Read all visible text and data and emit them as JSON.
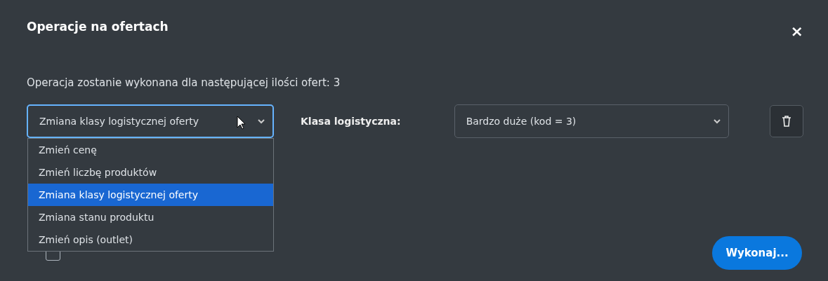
{
  "dialog": {
    "title": "Operacje na ofertach",
    "close": "×"
  },
  "summary": "Operacja zostanie wykonana dla następującej ilości ofert: 3",
  "operation_select": {
    "value": "Zmiana klasy logistycznej oferty",
    "expanded": true,
    "options": [
      {
        "label": "Zmień cenę",
        "selected": false
      },
      {
        "label": "Zmień liczbę produktów",
        "selected": false
      },
      {
        "label": "Zmiana klasy logistycznej oferty",
        "selected": true
      },
      {
        "label": "Zmiana stanu produktu",
        "selected": false
      },
      {
        "label": "Zmień opis (outlet)",
        "selected": false
      }
    ]
  },
  "class_label": "Klasa logistyczna:",
  "class_select": {
    "value": "Bardzo duże (kod = 3)"
  },
  "schedule_checkbox": {
    "checked": false
  },
  "execute_button": "Wykonaj..."
}
